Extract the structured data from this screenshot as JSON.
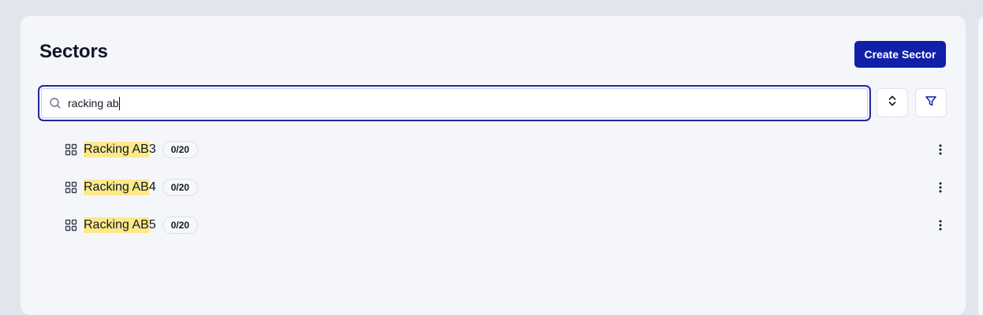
{
  "header": {
    "title": "Sectors",
    "create_button_label": "Create Sector"
  },
  "search": {
    "value": "racking ab",
    "placeholder": ""
  },
  "toolbar": {
    "sort_icon": "chevron-up-down-icon",
    "filter_icon": "funnel-icon"
  },
  "sectors": [
    {
      "highlight": "Racking AB",
      "rest": "3",
      "badge": "0/20"
    },
    {
      "highlight": "Racking AB",
      "rest": "4",
      "badge": "0/20"
    },
    {
      "highlight": "Racking AB",
      "rest": "5",
      "badge": "0/20"
    }
  ],
  "colors": {
    "primary": "#1020a8",
    "highlight": "#fde98a",
    "panel_bg": "#f5f6fa"
  }
}
